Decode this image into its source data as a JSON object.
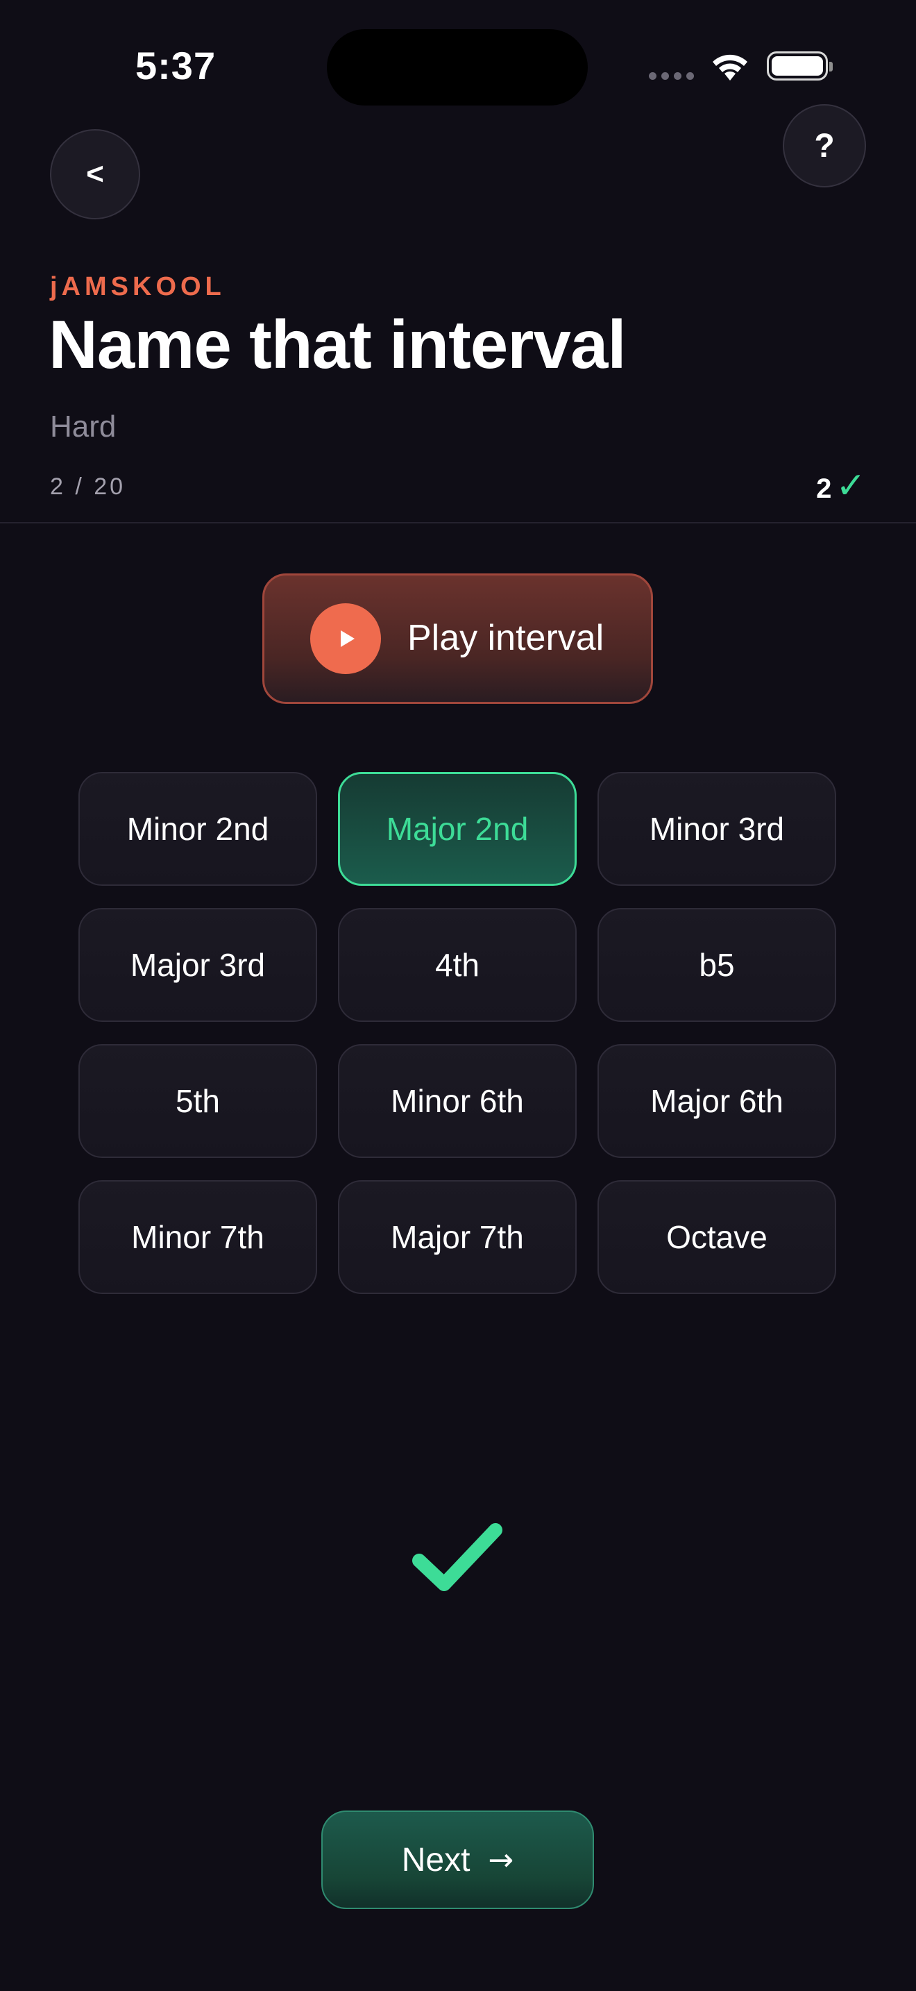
{
  "status_bar": {
    "time": "5:37"
  },
  "header": {
    "back_label": "<",
    "help_label": "?",
    "brand": "jAMSKOOL",
    "title": "Name that interval",
    "difficulty": "Hard",
    "progress": "2 / 20",
    "score": "2",
    "score_icon": "✓"
  },
  "player": {
    "play_label": "Play interval"
  },
  "options": [
    {
      "label": "Minor 2nd",
      "selected": false
    },
    {
      "label": "Major 2nd",
      "selected": true
    },
    {
      "label": "Minor 3rd",
      "selected": false
    },
    {
      "label": "Major 3rd",
      "selected": false
    },
    {
      "label": "4th",
      "selected": false
    },
    {
      "label": "b5",
      "selected": false
    },
    {
      "label": "5th",
      "selected": false
    },
    {
      "label": "Minor 6th",
      "selected": false
    },
    {
      "label": "Major 6th",
      "selected": false
    },
    {
      "label": "Minor 7th",
      "selected": false
    },
    {
      "label": "Major 7th",
      "selected": false
    },
    {
      "label": "Octave",
      "selected": false
    }
  ],
  "footer": {
    "next_label": "Next",
    "next_arrow": "→"
  },
  "colors": {
    "accent_orange": "#ee6b4d",
    "accent_green": "#3ddc97",
    "background": "#0f0d16"
  }
}
